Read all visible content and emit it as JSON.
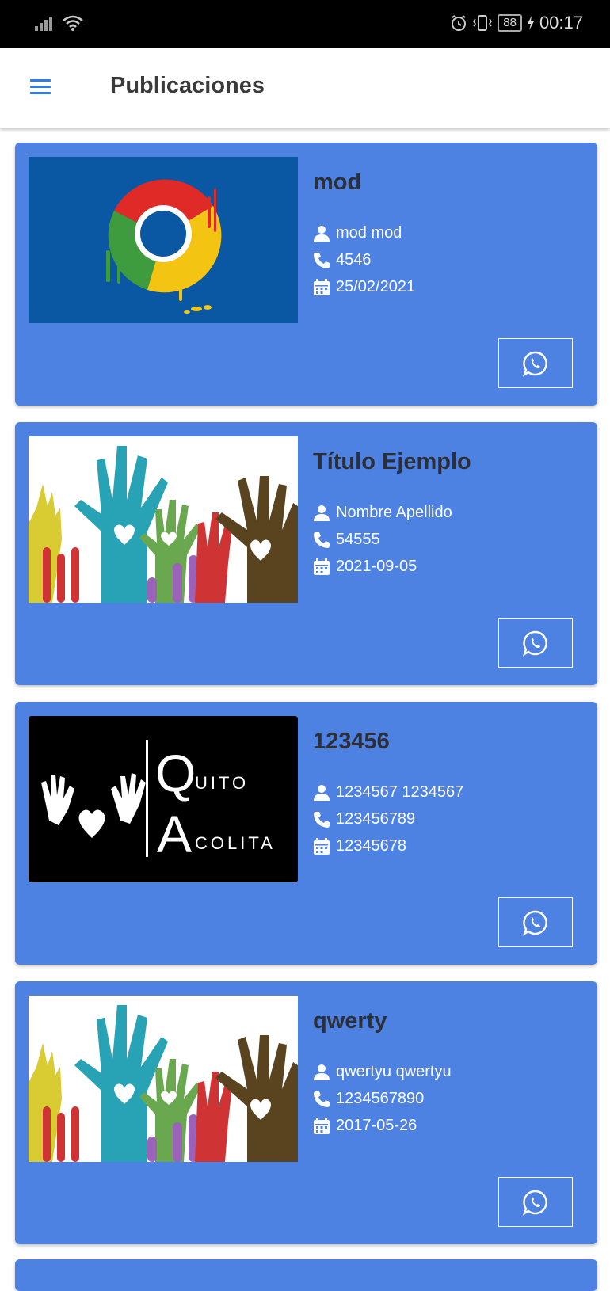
{
  "status_bar": {
    "time": "00:17",
    "battery": "88"
  },
  "app_bar": {
    "title": "Publicaciones",
    "menu_icon": "hamburger-menu-icon"
  },
  "icons": {
    "user": "user-icon",
    "phone": "phone-icon",
    "calendar": "calendar-icon",
    "whatsapp": "whatsapp-icon"
  },
  "colors": {
    "card_background": "#4d82e3",
    "accent": "#2f7bea",
    "title_text": "#2c2f38"
  },
  "publications": [
    {
      "title": "mod",
      "name": "mod mod",
      "phone": "4546",
      "date": "25/02/2021",
      "image": "chrome-logo-image"
    },
    {
      "title": "Título Ejemplo",
      "name": "Nombre Apellido",
      "phone": "54555",
      "date": "2021-09-05",
      "image": "raised-hands-image"
    },
    {
      "title": "123456",
      "name": "1234567 1234567",
      "phone": "123456789",
      "date": "12345678",
      "image": "quito-acolita-logo-image",
      "logo_text_top": "UITO",
      "logo_text_bottom": "COLITA",
      "logo_letter_q": "Q",
      "logo_letter_a": "A"
    },
    {
      "title": "qwerty",
      "name": "qwertyu qwertyu",
      "phone": "1234567890",
      "date": "2017-05-26",
      "image": "raised-hands-image"
    }
  ]
}
